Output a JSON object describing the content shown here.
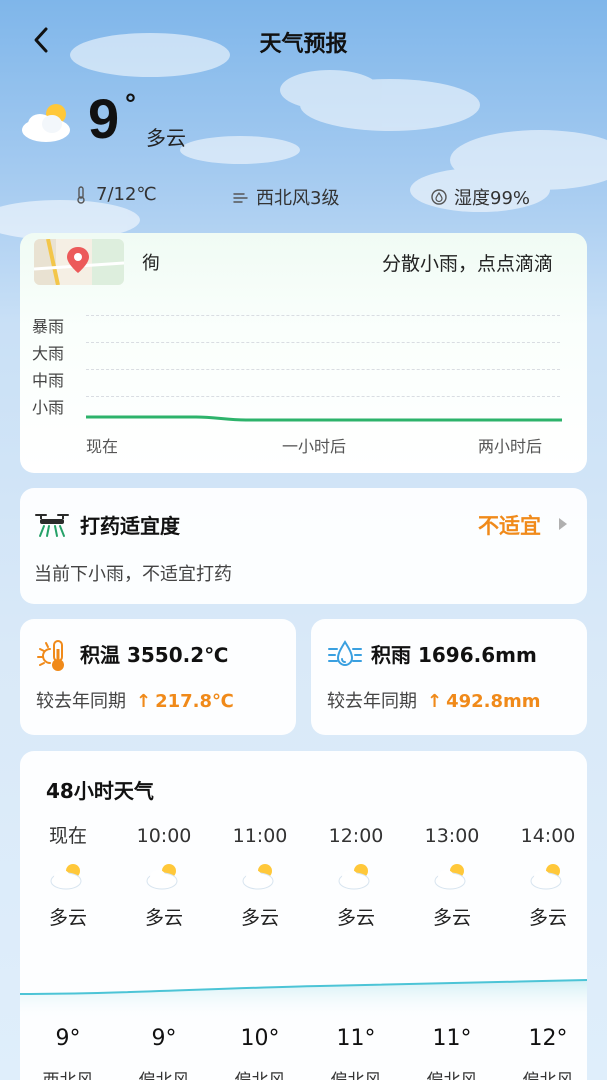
{
  "header": {
    "title": "天气预报"
  },
  "current": {
    "temp": "9",
    "degree_symbol": "°",
    "desc": "多云",
    "temp_range": "7/12℃",
    "wind": "西北风3级",
    "humidity": "湿度99%"
  },
  "rain_card": {
    "location": "徇",
    "summary": "分散小雨，点点滴滴",
    "y_levels": [
      "暴雨",
      "大雨",
      "中雨",
      "小雨"
    ],
    "x_labels": [
      "现在",
      "一小时后",
      "两小时后"
    ],
    "line_color": "#2db36b"
  },
  "spray": {
    "title": "打药适宜度",
    "status": "不适宜",
    "desc": "当前下小雨，不适宜打药",
    "status_color": "#f08a1a"
  },
  "accum_temp": {
    "label": "积温",
    "value": "3550.2℃",
    "compare_label": "较去年同期",
    "arrow": "↑",
    "delta": "217.8℃"
  },
  "accum_rain": {
    "label": "积雨",
    "value": "1696.6mm",
    "compare_label": "较去年同期",
    "arrow": "↑",
    "delta": "492.8mm"
  },
  "forecast48": {
    "title": "48小时天气",
    "hours": [
      {
        "time": "现在",
        "icon": "partly-cloudy-icon",
        "desc": "多云",
        "temp": "9°",
        "wind": "西北风"
      },
      {
        "time": "10:00",
        "icon": "partly-cloudy-icon",
        "desc": "多云",
        "temp": "9°",
        "wind": "偏北风"
      },
      {
        "time": "11:00",
        "icon": "partly-cloudy-icon",
        "desc": "多云",
        "temp": "10°",
        "wind": "偏北风"
      },
      {
        "time": "12:00",
        "icon": "partly-cloudy-icon",
        "desc": "多云",
        "temp": "11°",
        "wind": "偏北风"
      },
      {
        "time": "13:00",
        "icon": "partly-cloudy-icon",
        "desc": "多云",
        "temp": "11°",
        "wind": "偏北风"
      },
      {
        "time": "14:00",
        "icon": "partly-cloudy-icon",
        "desc": "多云",
        "temp": "12°",
        "wind": "偏北风"
      }
    ]
  }
}
